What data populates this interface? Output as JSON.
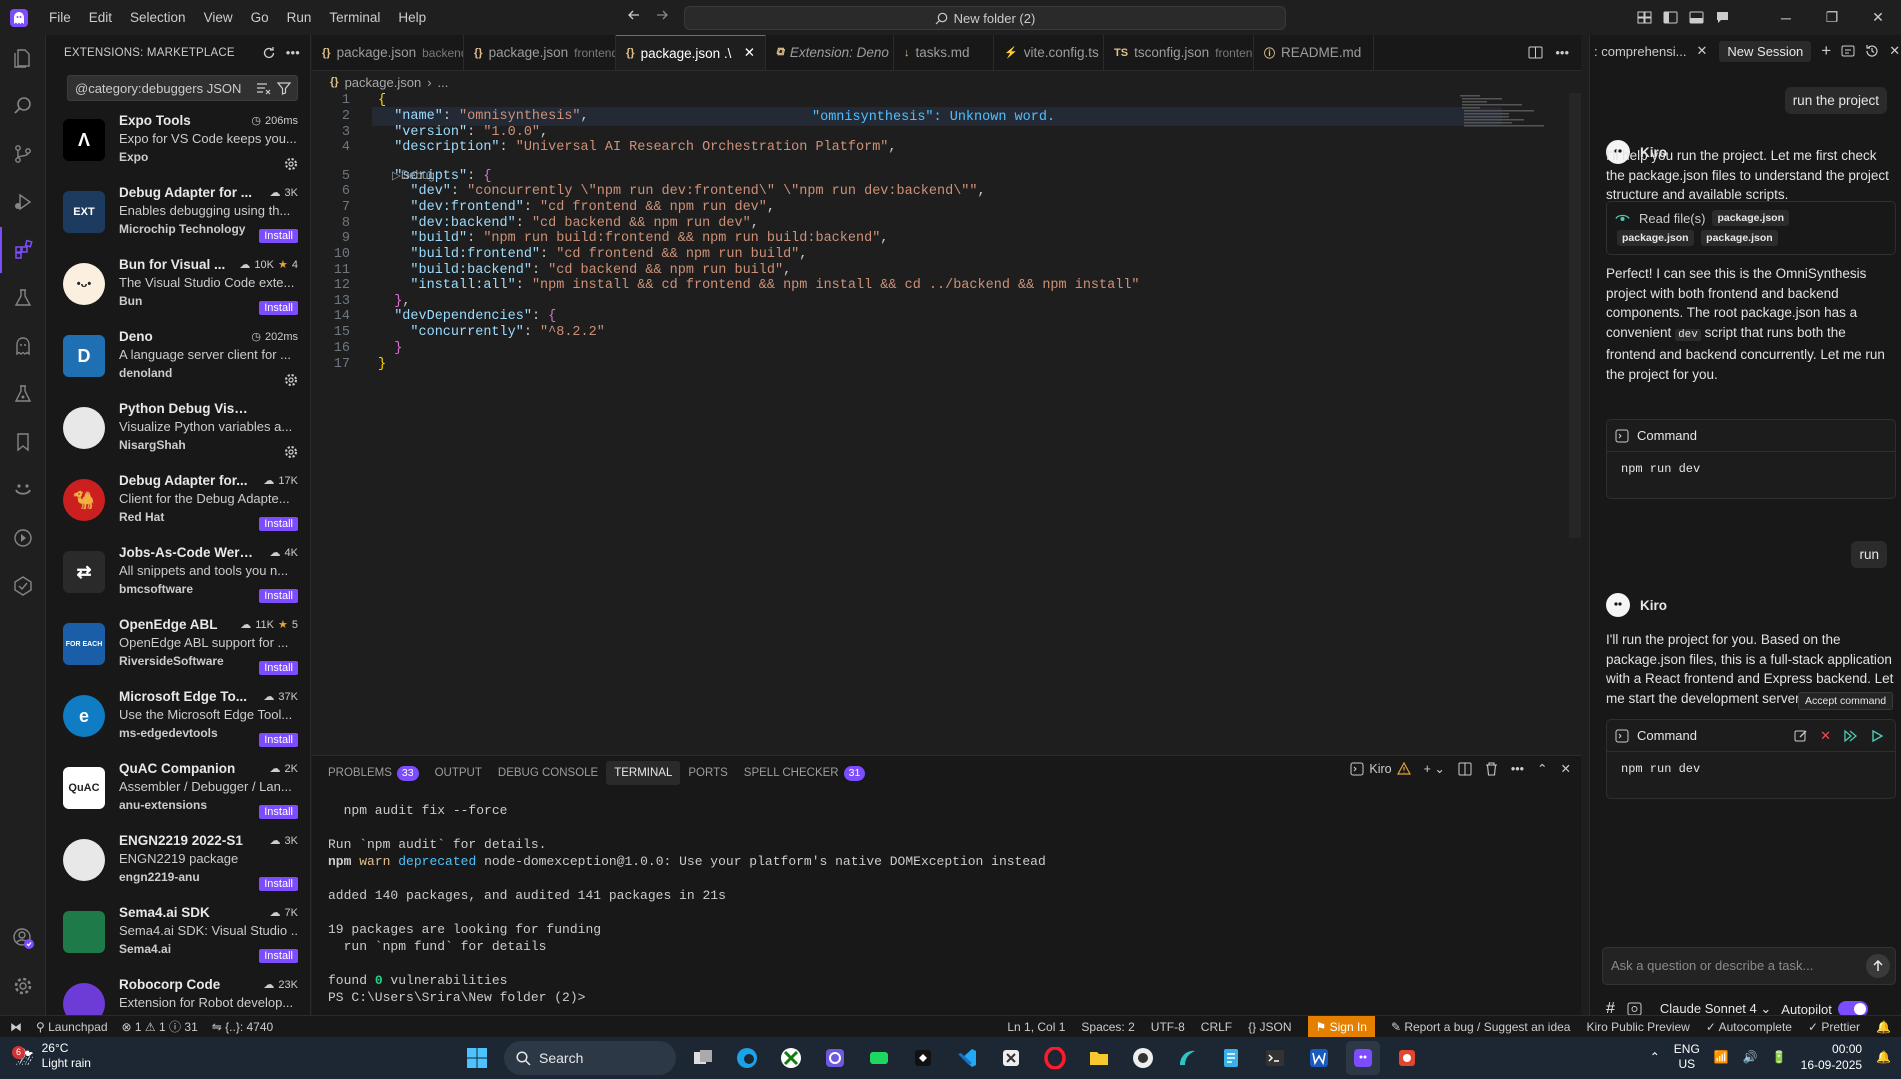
{
  "menus": [
    "File",
    "Edit",
    "Selection",
    "View",
    "Go",
    "Run",
    "Terminal",
    "Help"
  ],
  "command_center": "New folder (2)",
  "sidebar": {
    "title": "EXTENSIONS: MARKETPLACE",
    "search_value": "@category:debuggers JSON",
    "install_label": "Install",
    "extensions": [
      {
        "name": "Expo Tools",
        "desc": "Expo for VS Code keeps you...",
        "publisher": "Expo",
        "stat": "206ms",
        "stat_kind": "time",
        "action": "gear",
        "icon_bg": "#000000",
        "icon_text": "Λ"
      },
      {
        "name": "Debug Adapter for ...",
        "desc": "Enables debugging using th...",
        "publisher": "Microchip Technology",
        "stat": "3K",
        "stat_kind": "dl",
        "action": "install",
        "icon_bg": "#1d3b5f",
        "icon_text": "EXT"
      },
      {
        "name": "Bun for Visual ...",
        "desc": "The Visual Studio Code exte...",
        "publisher": "Bun",
        "stat": "10K",
        "rating": "4",
        "stat_kind": "dl",
        "action": "install",
        "icon_bg": "#fbf0df",
        "icon_text": "•ᴗ•"
      },
      {
        "name": "Deno",
        "desc": "A language server client for ...",
        "publisher": "denoland",
        "stat": "202ms",
        "stat_kind": "time",
        "action": "gear",
        "icon_bg": "#1f6fb3",
        "icon_text": "D"
      },
      {
        "name": "Python Debug Visualizer",
        "desc": "Visualize Python variables a...",
        "publisher": "NisargShah",
        "stat": "",
        "stat_kind": "none",
        "action": "gear",
        "icon_bg": "#e8e8e8",
        "icon_text": ""
      },
      {
        "name": "Debug Adapter for...",
        "desc": "Client for the Debug Adapte...",
        "publisher": "Red Hat",
        "stat": "17K",
        "stat_kind": "dl",
        "action": "install",
        "icon_bg": "#cc1f1f",
        "icon_text": "🐪"
      },
      {
        "name": "Jobs-As-Code Werk...",
        "desc": "All snippets and tools you n...",
        "publisher": "bmcsoftware",
        "stat": "4K",
        "stat_kind": "dl",
        "action": "install",
        "icon_bg": "#2a2a2a",
        "icon_text": "⇄"
      },
      {
        "name": "OpenEdge ABL",
        "desc": "OpenEdge ABL support for ...",
        "publisher": "RiversideSoftware",
        "stat": "11K",
        "rating": "5",
        "stat_kind": "dl",
        "action": "install",
        "icon_bg": "#1a5ea8",
        "icon_text": "FOR EACH"
      },
      {
        "name": "Microsoft Edge To...",
        "desc": "Use the Microsoft Edge Tool...",
        "publisher": "ms-edgedevtools",
        "stat": "37K",
        "stat_kind": "dl",
        "action": "install",
        "icon_bg": "#0f7cc4",
        "icon_text": "e"
      },
      {
        "name": "QuAC Companion",
        "desc": "Assembler / Debugger / Lan...",
        "publisher": "anu-extensions",
        "stat": "2K",
        "stat_kind": "dl",
        "action": "install",
        "icon_bg": "#ffffff",
        "icon_text": "QuAC"
      },
      {
        "name": "ENGN2219 2022-S1",
        "desc": "ENGN2219 package",
        "publisher": "engn2219-anu",
        "stat": "3K",
        "stat_kind": "dl",
        "action": "install",
        "icon_bg": "#e8e8e8",
        "icon_text": ""
      },
      {
        "name": "Sema4.ai SDK",
        "desc": "Sema4.ai SDK: Visual Studio ...",
        "publisher": "Sema4.ai",
        "stat": "7K",
        "stat_kind": "dl",
        "action": "install",
        "icon_bg": "#1f7a4a",
        "icon_text": "</>"
      },
      {
        "name": "Robocorp Code",
        "desc": "Extension for Robot develop...",
        "publisher": "",
        "stat": "23K",
        "stat_kind": "dl",
        "action": "none",
        "icon_bg": "#6d3bd6",
        "icon_text": ""
      }
    ]
  },
  "tabs": [
    {
      "label": "package.json",
      "sub": "backend",
      "icon": "{}"
    },
    {
      "label": "package.json",
      "sub": "frontend",
      "icon": "{}"
    },
    {
      "label": "package.json .\\",
      "sub": "",
      "icon": "{}",
      "active": true
    },
    {
      "label": "Extension: Deno",
      "sub": "",
      "icon": "⧉",
      "italic": true
    },
    {
      "label": "tasks.md",
      "sub": "",
      "icon": "↓"
    },
    {
      "label": "vite.config.ts",
      "sub": "",
      "icon": "⚡"
    },
    {
      "label": "tsconfig.json",
      "sub": "frontend",
      "icon": "TS"
    },
    {
      "label": "README.md",
      "sub": "",
      "icon": "ⓘ"
    }
  ],
  "breadcrumb": {
    "file": "package.json",
    "rest": "..."
  },
  "editor": {
    "inline_error": "\"omnisynthesis\": Unknown word.",
    "codelens": "Debug",
    "lines": [
      {
        "n": "1",
        "t": "{"
      },
      {
        "n": "2",
        "t": "  \"name\": \"omnisynthesis\","
      },
      {
        "n": "3",
        "t": "  \"version\": \"1.0.0\","
      },
      {
        "n": "4",
        "t": "  \"description\": \"Universal AI Research Orchestration Platform\","
      },
      {
        "n": "5",
        "t": "  \"scripts\": {"
      },
      {
        "n": "6",
        "t": "    \"dev\": \"concurrently \\\"npm run dev:frontend\\\" \\\"npm run dev:backend\\\"\","
      },
      {
        "n": "7",
        "t": "    \"dev:frontend\": \"cd frontend && npm run dev\","
      },
      {
        "n": "8",
        "t": "    \"dev:backend\": \"cd backend && npm run dev\","
      },
      {
        "n": "9",
        "t": "    \"build\": \"npm run build:frontend && npm run build:backend\","
      },
      {
        "n": "10",
        "t": "    \"build:frontend\": \"cd frontend && npm run build\","
      },
      {
        "n": "11",
        "t": "    \"build:backend\": \"cd backend && npm run build\","
      },
      {
        "n": "12",
        "t": "    \"install:all\": \"npm install && cd frontend && npm install && cd ../backend && npm install\""
      },
      {
        "n": "13",
        "t": "  },"
      },
      {
        "n": "14",
        "t": "  \"devDependencies\": {"
      },
      {
        "n": "15",
        "t": "    \"concurrently\": \"^8.2.2\""
      },
      {
        "n": "16",
        "t": "  }"
      },
      {
        "n": "17",
        "t": "}"
      }
    ]
  },
  "panel": {
    "tabs": [
      {
        "label": "PROBLEMS",
        "count": "33"
      },
      {
        "label": "OUTPUT",
        "count": ""
      },
      {
        "label": "DEBUG CONSOLE",
        "count": ""
      },
      {
        "label": "TERMINAL",
        "count": "",
        "active": true
      },
      {
        "label": "PORTS",
        "count": ""
      },
      {
        "label": "SPELL CHECKER",
        "count": "31"
      }
    ],
    "terminal_name": "Kiro",
    "terminal_lines": [
      "  npm audit fix --force",
      "",
      "Run `npm audit` for details.",
      "npm warn deprecated node-domexception@1.0.0: Use your platform's native DOMException instead",
      "",
      "added 140 packages, and audited 141 packages in 21s",
      "",
      "19 packages are looking for funding",
      "  run `npm fund` for details",
      "",
      "found 0 vulnerabilities",
      "PS C:\\Users\\Srira\\New folder (2)>"
    ]
  },
  "chat": {
    "tab_label": ": comprehensi...",
    "new_session": "New Session",
    "user_msg_1": "run the project",
    "assistant_name": "Kiro",
    "reply_1": "I'll help you run the project. Let me first check the package.json files to understand the project structure and available scripts.",
    "read_files_label": "Read file(s)",
    "read_files": [
      "package.json",
      "package.json",
      "package.json"
    ],
    "reply_2a": "Perfect! I can see this is the OmniSynthesis project with both frontend and backend components. The root package.json has a convenient",
    "reply_2_code": "dev",
    "reply_2b": "script that runs both the frontend and backend concurrently. Let me run the project for you.",
    "command_label": "Command",
    "command_1": "npm run dev",
    "user_msg_2": "run",
    "reply_3": "I'll run the project for you. Based on the package.json files, this is a full-stack application with a React frontend and Express backend. Let me start the development servers:",
    "accept_tip": "Accept command",
    "command_2": "npm run dev",
    "input_placeholder": "Ask a question or describe a task...",
    "model": "Claude Sonnet 4",
    "autopilot": "Autopilot"
  },
  "status": {
    "launchpad": "Launchpad",
    "errors": "1",
    "warnings": "1",
    "infos": "31",
    "port": "{..}: 4740",
    "cursor": "Ln 1, Col 1",
    "spaces": "Spaces: 2",
    "encoding": "UTF-8",
    "eol": "CRLF",
    "lang": "JSON",
    "signin": "Sign In",
    "report": "Report a bug / Suggest an idea",
    "preview": "Kiro Public Preview",
    "autocomplete": "Autocomplete",
    "prettier": "Prettier"
  },
  "taskbar": {
    "temp": "26°C",
    "weather": "Light rain",
    "weather_badge": "6",
    "search": "Search",
    "lang1": "ENG",
    "lang2": "US",
    "time": "00:00",
    "date": "16-09-2025"
  },
  "colors": {
    "accent": "#7c4dff",
    "signin": "#e57f00"
  }
}
